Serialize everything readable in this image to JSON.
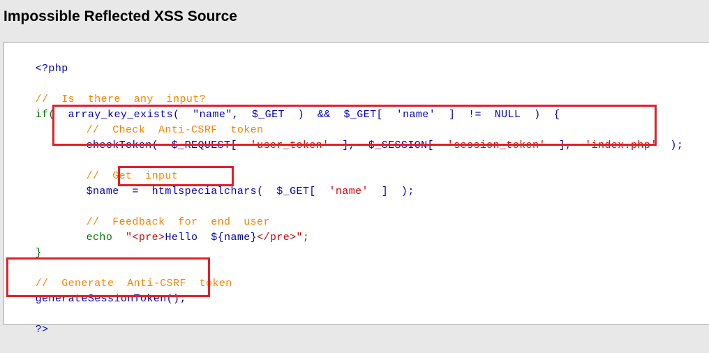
{
  "page": {
    "title": "Impossible Reflected XSS Source"
  },
  "code": {
    "open_tag": "<?php",
    "comment_input": "//  Is  there  any  input?",
    "if_kw": "if(",
    "if_cond": "  array_key_exists(  \"name\",  $_GET  )  &&  $_GET[  'name'  ]  !=  NULL  )  {",
    "comment_csrf": "//  Check  Anti-CSRF  token",
    "checktoken_fn": "checkToken(  ",
    "checktoken_args_a": "$_REQUEST[  ",
    "checktoken_str_a": "'user_token'",
    "checktoken_args_b": "  ],  $_SESSION[  ",
    "checktoken_str_b": "'session_token'",
    "checktoken_args_c": "  ],  ",
    "checktoken_str_c": "'index.php'",
    "checktoken_end": "  );",
    "comment_get": "//  Get  input",
    "name_var": "$name  =  ",
    "name_fn": "htmlspecialchars",
    "name_args": "(  $_GET[  ",
    "name_str": "'name'",
    "name_end": "  ]  );",
    "comment_feedback": "//  Feedback  for  end  user",
    "echo_kw": "echo  ",
    "echo_str_a": "\"",
    "echo_tag_pre_open": "<pre>",
    "echo_str_b": "Hello  ${",
    "echo_var": "name",
    "echo_str_c": "}",
    "echo_tag_pre_close": "</pre>",
    "echo_str_d": "\"",
    "echo_end": ";",
    "close_brace": "}",
    "comment_generate": "//  Generate  Anti-CSRF  token",
    "generate_fn": "generateSessionToken();",
    "close_tag": "?>"
  },
  "colors": {
    "default": "#0000bb",
    "comment": "#ff8000",
    "keyword": "#007700",
    "string": "#dd0000",
    "highlight_box": "#e0202a"
  }
}
